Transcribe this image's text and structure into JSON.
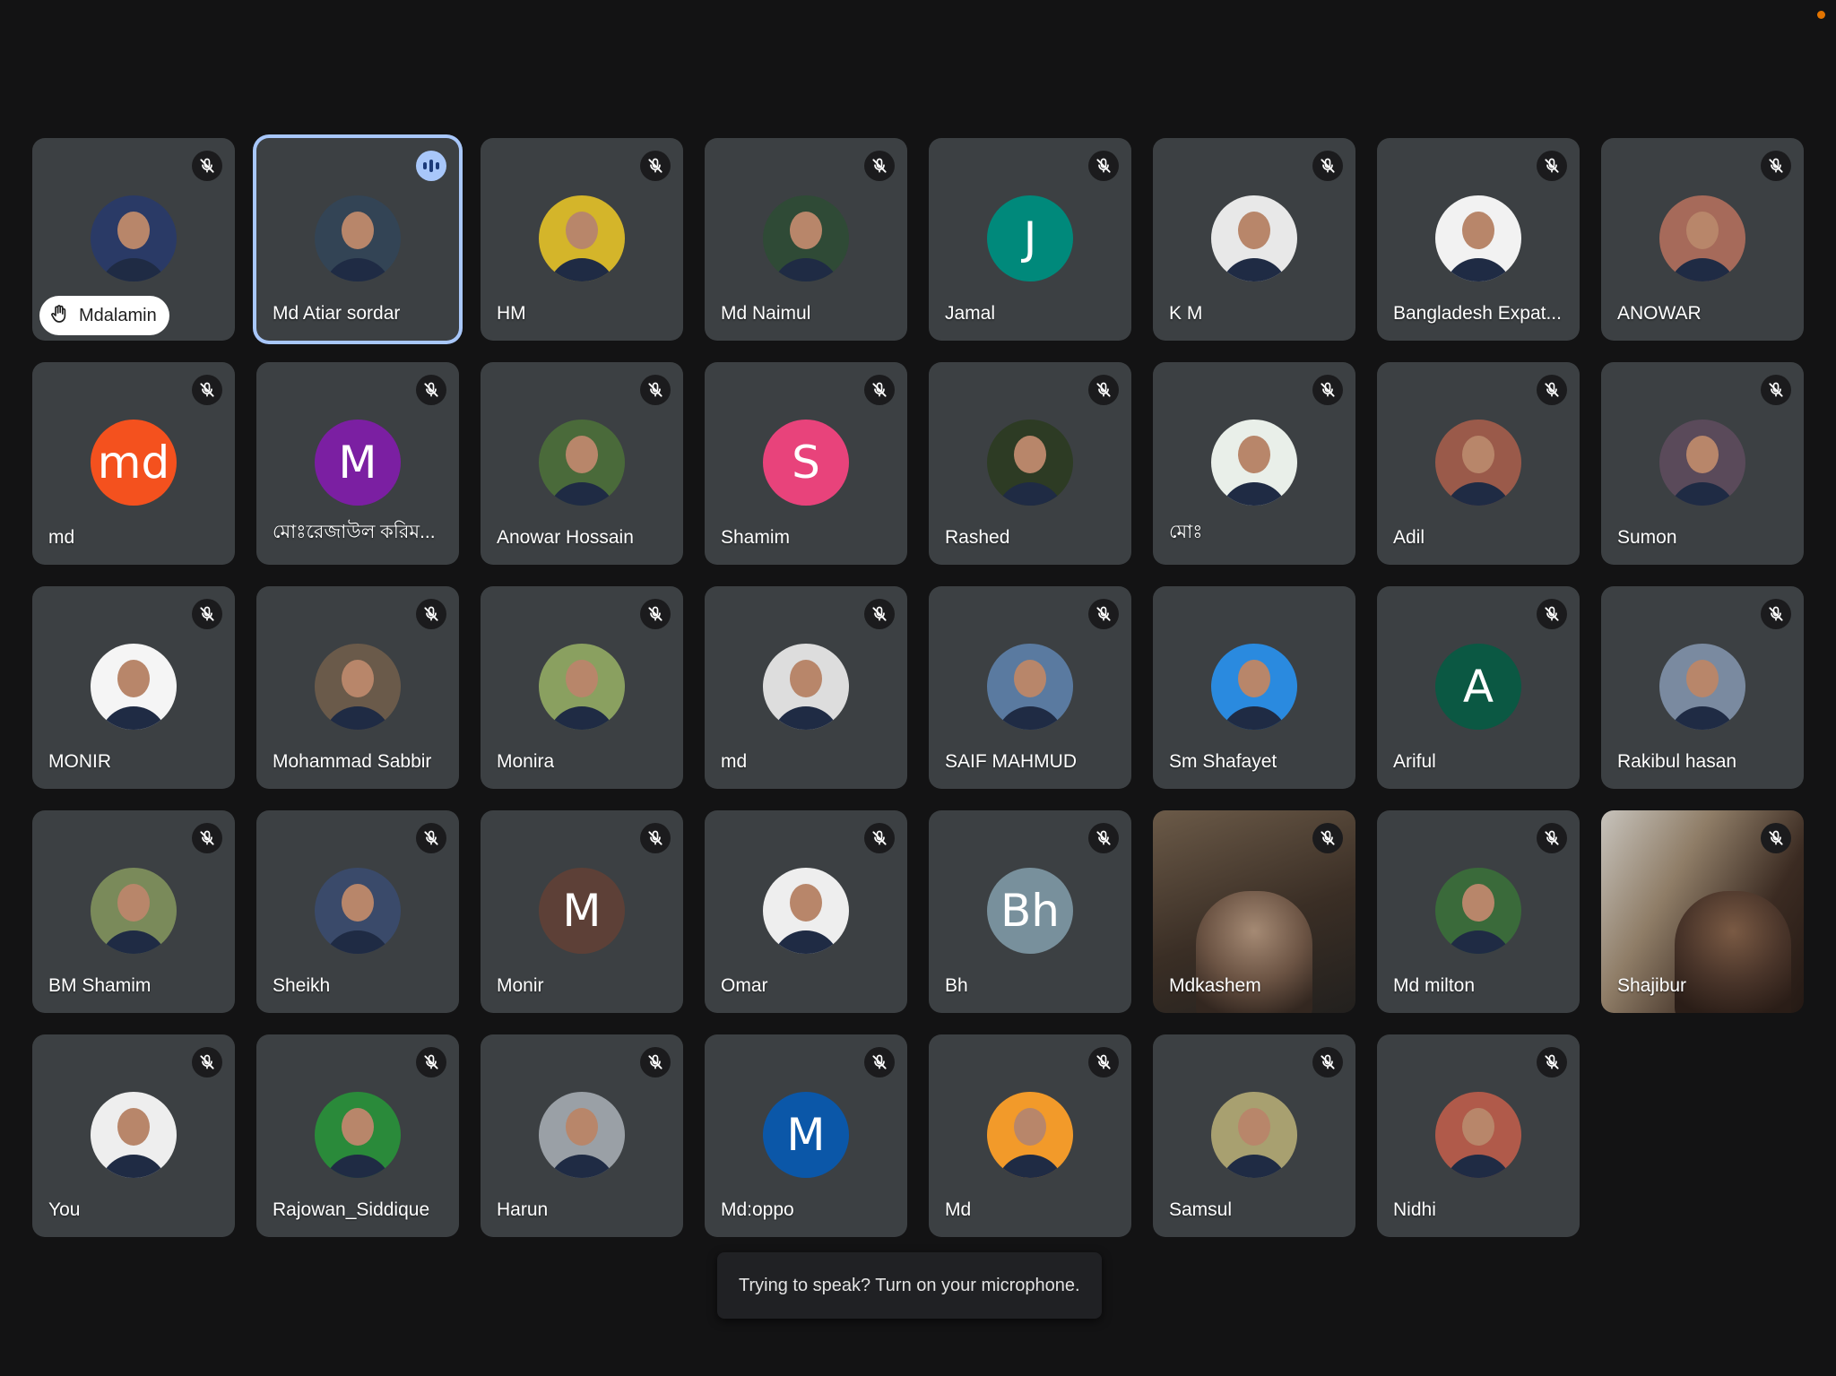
{
  "toast": {
    "text": "Trying to speak? Turn on your microphone."
  },
  "colors": {
    "tile": "#3c4043",
    "background": "#131314",
    "speaking_outline": "#a8c7fa",
    "status_dot": "#e37400"
  },
  "participants": [
    {
      "name": "Mdalamin",
      "avatar": "photo",
      "photo_tone": "#2a3a66",
      "mic": "off",
      "hand_raised": true
    },
    {
      "name": "Md Atiar sordar",
      "avatar": "photo",
      "photo_tone": "#345",
      "mic": "speaking"
    },
    {
      "name": "HM",
      "avatar": "photo",
      "photo_tone": "#d4b52a",
      "mic": "off"
    },
    {
      "name": "Md Naimul",
      "avatar": "photo",
      "photo_tone": "#2f4a36",
      "mic": "off"
    },
    {
      "name": "Jamal",
      "avatar": "initial",
      "initial": "J",
      "color": "#00897b",
      "mic": "off"
    },
    {
      "name": "K M",
      "avatar": "photo",
      "photo_tone": "#e8e8e8",
      "mic": "off"
    },
    {
      "name": "Bangladesh Expat...",
      "avatar": "photo",
      "photo_tone": "#f2f2f2",
      "mic": "off"
    },
    {
      "name": "ANOWAR",
      "avatar": "photo",
      "photo_tone": "#a66a5a",
      "mic": "off"
    },
    {
      "name": "md",
      "avatar": "initial",
      "initial": "md",
      "color": "#f4511e",
      "mic": "off"
    },
    {
      "name": "মোঃরেজাউল করিম...",
      "avatar": "initial",
      "initial": "M",
      "color": "#7b1fa2",
      "mic": "off"
    },
    {
      "name": "Anowar Hossain",
      "avatar": "photo",
      "photo_tone": "#4a6a3a",
      "mic": "off"
    },
    {
      "name": "Shamim",
      "avatar": "initial",
      "initial": "S",
      "color": "#e8437b",
      "mic": "off"
    },
    {
      "name": "Rashed",
      "avatar": "photo",
      "photo_tone": "#2d3b24",
      "mic": "off"
    },
    {
      "name": "মোঃ",
      "avatar": "photo",
      "photo_tone": "#e9efe9",
      "mic": "off"
    },
    {
      "name": "Adil",
      "avatar": "photo",
      "photo_tone": "#9a5a4a",
      "mic": "off"
    },
    {
      "name": "Sumon",
      "avatar": "photo",
      "photo_tone": "#5a4a5a",
      "mic": "off"
    },
    {
      "name": "MONIR",
      "avatar": "photo",
      "photo_tone": "#f5f5f5",
      "mic": "off"
    },
    {
      "name": "Mohammad Sabbir",
      "avatar": "photo",
      "photo_tone": "#6a5a4a",
      "mic": "off"
    },
    {
      "name": "Monira",
      "avatar": "photo",
      "photo_tone": "#8aa060",
      "mic": "off"
    },
    {
      "name": "md",
      "avatar": "photo",
      "photo_tone": "#dddddd",
      "mic": "off"
    },
    {
      "name": "SAIF MAHMUD",
      "avatar": "photo",
      "photo_tone": "#5a7aa0",
      "mic": "off"
    },
    {
      "name": "Sm Shafayet",
      "avatar": "photo",
      "photo_tone": "#2a8adf",
      "mic": "none"
    },
    {
      "name": "Ariful",
      "avatar": "initial",
      "initial": "A",
      "color": "#0b5843",
      "mic": "off"
    },
    {
      "name": "Rakibul hasan",
      "avatar": "photo",
      "photo_tone": "#7a8aa0",
      "mic": "off"
    },
    {
      "name": "BM Shamim",
      "avatar": "photo",
      "photo_tone": "#7a8a5a",
      "mic": "off"
    },
    {
      "name": "Sheikh",
      "avatar": "photo",
      "photo_tone": "#3a4a6a",
      "mic": "off"
    },
    {
      "name": "Monir",
      "avatar": "initial",
      "initial": "M",
      "color": "#5d4037",
      "mic": "off"
    },
    {
      "name": "Omar",
      "avatar": "photo",
      "photo_tone": "#eeeeee",
      "mic": "off"
    },
    {
      "name": "Bh",
      "avatar": "initial",
      "initial": "Bh",
      "color": "#78909c",
      "mic": "off"
    },
    {
      "name": "Mdkashem",
      "avatar": "video",
      "mic": "off"
    },
    {
      "name": "Md milton",
      "avatar": "photo",
      "photo_tone": "#3a6a3a",
      "mic": "off"
    },
    {
      "name": "Shajibur",
      "avatar": "video_alt",
      "mic": "off"
    },
    {
      "name": "You",
      "avatar": "photo",
      "photo_tone": "#eeeeee",
      "mic": "off"
    },
    {
      "name": "Rajowan_Siddique",
      "avatar": "photo",
      "photo_tone": "#2a8a3a",
      "mic": "off"
    },
    {
      "name": "Harun",
      "avatar": "photo",
      "photo_tone": "#9aa0a6",
      "mic": "off"
    },
    {
      "name": "Md:oppo",
      "avatar": "initial",
      "initial": "M",
      "color": "#0b57a8",
      "mic": "off"
    },
    {
      "name": "Md",
      "avatar": "photo",
      "photo_tone": "#f29a2a",
      "mic": "off"
    },
    {
      "name": "Samsul",
      "avatar": "photo",
      "photo_tone": "#a8a070",
      "mic": "off"
    },
    {
      "name": "Nidhi",
      "avatar": "photo",
      "photo_tone": "#b05a4a",
      "mic": "off"
    }
  ]
}
